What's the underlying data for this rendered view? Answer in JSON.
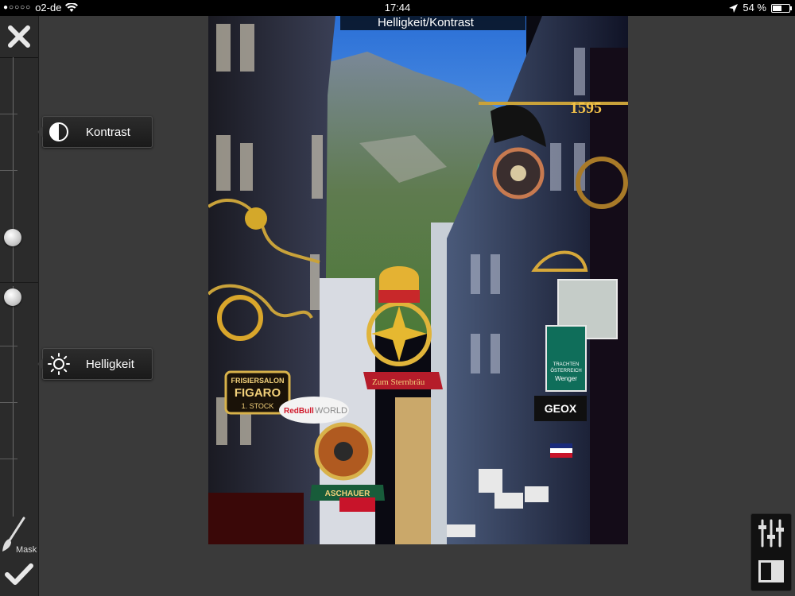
{
  "status_bar": {
    "carrier": "o2-de",
    "time": "17:44",
    "battery_percent": "54 %",
    "battery_level": 0.54,
    "icons": [
      "signal-dots-icon",
      "wifi-icon",
      "location-arrow-icon",
      "battery-icon"
    ]
  },
  "toolbar": {
    "close_icon": "close-x-icon",
    "mask_label": "Mask",
    "mask_icon": "brush-icon",
    "confirm_icon": "checkmark-icon"
  },
  "sliders": [
    {
      "label": "Kontrast",
      "icon": "contrast-icon"
    },
    {
      "label": "Helligkeit",
      "icon": "sun-icon"
    }
  ],
  "image_title": "Helligkeit/Kontrast",
  "photo_signs": {
    "year": "1595",
    "salon_line1": "FRISIERSALON",
    "salon_line2": "FIGARO",
    "salon_line3": "1. STOCK",
    "redbull": "RedBull",
    "world": "WORLD",
    "geox": "GEOX",
    "sternbraeu": "Zum Sternbräu",
    "aschauer": "ASCHAUER",
    "trachten_line1": "TRACHTEN",
    "trachten_line2": "ÖSTERREICH",
    "trachten_line3": "Wenger"
  },
  "right_tools": {
    "adjust_icon": "sliders-icon",
    "compare_icon": "split-view-icon"
  },
  "colors": {
    "background": "#3a3a3a",
    "toolbar": "#2b2b2b",
    "status_bar": "#000000"
  }
}
